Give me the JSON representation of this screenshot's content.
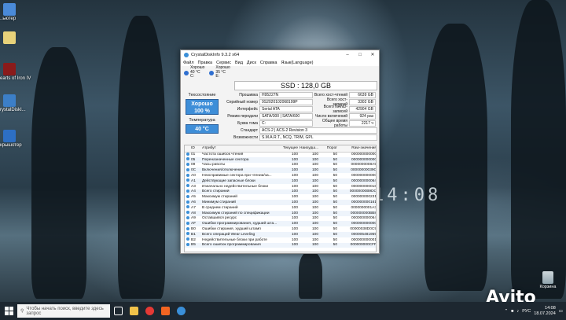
{
  "desktop": {
    "icons": [
      {
        "label": "..ьютер",
        "color": "#4a8ad8"
      },
      {
        "label": "",
        "color": "#e8d27a"
      },
      {
        "label": "earts of Iron IV",
        "color": "#8a1b1b"
      },
      {
        "label": "rystalDiskI...",
        "color": "#3c7fc8"
      },
      {
        "label": "крышотер",
        "color": "#2d6fc4"
      }
    ],
    "bg_clock": "14:08",
    "recycle_label": "Корзина"
  },
  "window": {
    "title": "CrystalDiskInfo 9.3.2 x64",
    "menu": [
      "Файл",
      "Правка",
      "Сервис",
      "Вид",
      "Диск",
      "Справка",
      "Язык(Language)"
    ],
    "drives": [
      {
        "status": "Хорошо",
        "temp": "40 °C",
        "letter": "C:"
      },
      {
        "status": "Хорошо",
        "temp": "35 °C",
        "letter": "E:"
      }
    ],
    "disk_title": "SSD : 128,0 GB",
    "health_label": "Техсостояние",
    "health_status": "Хорошо",
    "health_percent": "100 %",
    "temp_label": "Температура",
    "temp_value": "40 °C",
    "info_left": [
      {
        "k": "Прошивка",
        "v": "H95227N"
      },
      {
        "k": "Серийный номер",
        "v": "9S2020102068199P"
      },
      {
        "k": "Интерфейс",
        "v": "Serial ATA"
      },
      {
        "k": "Режим передачи",
        "v": "SATA/300 | SATA/600"
      },
      {
        "k": "Буква тома",
        "v": "C:"
      }
    ],
    "info_right": [
      {
        "k": "Всего хост-чтений",
        "v": "6639 GB"
      },
      {
        "k": "Всего хост-записей",
        "v": "3302 GB"
      },
      {
        "k": "Всего NAND-записей",
        "v": "42904 GB"
      },
      {
        "k": "Число включений",
        "v": "924 раз"
      },
      {
        "k": "Общее время работы",
        "v": "2217 ч"
      }
    ],
    "standard_label": "Стандарт",
    "standard_value": "ACS-2 | ACS-2 Revision 3",
    "features_label": "Возможности",
    "features_value": "S.M.A.R.T., NCQ, TRIM, GPL",
    "smart_headers": [
      "ID",
      "Атрибут",
      "Текущее",
      "Наихудш...",
      "Порог",
      "Raw-значения"
    ],
    "smart_rows": [
      [
        "01",
        "Частота ошибок чтения",
        "100",
        "100",
        "50",
        "000000000000"
      ],
      [
        "05",
        "Переназначенные сектора",
        "100",
        "100",
        "50",
        "000000000000"
      ],
      [
        "09",
        "Часы работы",
        "100",
        "100",
        "50",
        "0000000008A9"
      ],
      [
        "0C",
        "Включения/отключения",
        "100",
        "100",
        "50",
        "00000000039C"
      ],
      [
        "A0",
        "Неисправимые сектора при чтении/за...",
        "100",
        "100",
        "50",
        "000000000000"
      ],
      [
        "A1",
        "Действующие запасные блоки",
        "100",
        "100",
        "50",
        "000000000064"
      ],
      [
        "A3",
        "Изначально недействительные блоки",
        "100",
        "100",
        "50",
        "000000000018"
      ],
      [
        "A4",
        "Всего стираний",
        "100",
        "100",
        "50",
        "00000000B9DC"
      ],
      [
        "A5",
        "Максимум стираний",
        "100",
        "100",
        "50",
        "000000000231"
      ],
      [
        "A6",
        "Минимум стираний",
        "100",
        "100",
        "50",
        "000000000161"
      ],
      [
        "A7",
        "В среднем стираний",
        "100",
        "100",
        "50",
        "0000000001A3"
      ],
      [
        "A8",
        "Максимум стираний по спецификации",
        "100",
        "100",
        "50",
        "000000000BB8"
      ],
      [
        "A9",
        "Оставшийся ресурс",
        "100",
        "100",
        "50",
        "000000000064"
      ],
      [
        "AF",
        "Ошибки программирования, худший шта...",
        "100",
        "100",
        "50",
        "000000000000"
      ],
      [
        "B0",
        "Ошибки стирания, худший штамп",
        "100",
        "100",
        "50",
        "00000038D0C9"
      ],
      [
        "B1",
        "Всего операций Wear Leveling",
        "100",
        "100",
        "50",
        "000005481959"
      ],
      [
        "B2",
        "Недействительные блоки при работе",
        "100",
        "100",
        "50",
        "000000000001"
      ],
      [
        "B5",
        "Всего ошибок программирования",
        "100",
        "100",
        "50",
        "000000000CFF"
      ]
    ]
  },
  "taskbar": {
    "search_placeholder": "Чтобы начать поиск, введите здесь запрос",
    "lang": "РУС",
    "time": "14:08",
    "date": "18.07.2024"
  },
  "watermark": "Avito"
}
